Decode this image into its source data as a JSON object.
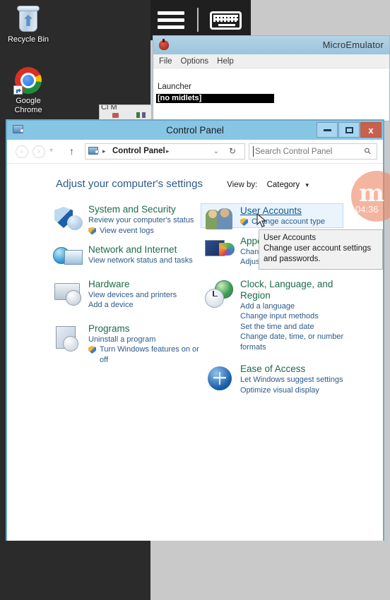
{
  "desktop": {
    "icons": [
      {
        "label": "Recycle Bin",
        "icon": "recycle-bin-icon"
      },
      {
        "label": "Google\nChrome",
        "label_line1": "Google",
        "label_line2": "Chrome",
        "icon": "google-chrome-icon"
      }
    ]
  },
  "emulator_overlay": {
    "menu_icon": "hamburger-icon",
    "keyboard_icon": "keyboard-icon"
  },
  "microemulator": {
    "title": "MicroEmulator",
    "window_icon": "microemulator-icon",
    "menus": [
      "File",
      "Options",
      "Help"
    ],
    "launcher_label": "Launcher",
    "selected_item": "[no midlets]"
  },
  "background_window": {
    "title_fragment": "Cl   M"
  },
  "control_panel": {
    "window_title": "Control Panel",
    "window_icon": "control-panel-icon",
    "window_buttons": {
      "minimize": "minimize-icon",
      "maximize": "maximize-icon",
      "close": "x"
    },
    "nav": {
      "back": "‹",
      "forward": "›",
      "recent_chevron": "▾",
      "up": "↑",
      "address_icon": "control-panel-icon",
      "breadcrumb_separator_1": "▸",
      "breadcrumb": "Control Panel",
      "breadcrumb_separator_2": "▸",
      "dropdown": "⌄",
      "refresh": "↻"
    },
    "search": {
      "placeholder": "Search Control Panel",
      "value": "",
      "icon": "search-icon"
    },
    "headline": "Adjust your computer's settings",
    "view_by": {
      "label": "View by:",
      "value": "Category",
      "arrow": "▾"
    },
    "categories_left": [
      {
        "title": "System and Security",
        "icon": "shield-icon",
        "links": [
          {
            "text": "Review your computer's status",
            "shield": false
          },
          {
            "text": "View event logs",
            "shield": true
          }
        ]
      },
      {
        "title": "Network and Internet",
        "icon": "network-icon",
        "links": [
          {
            "text": "View network status and tasks",
            "shield": false
          }
        ]
      },
      {
        "title": "Hardware",
        "icon": "hardware-icon",
        "links": [
          {
            "text": "View devices and printers",
            "shield": false
          },
          {
            "text": "Add a device",
            "shield": false
          }
        ]
      },
      {
        "title": "Programs",
        "icon": "programs-icon",
        "links": [
          {
            "text": "Uninstall a program",
            "shield": false
          },
          {
            "text": "Turn Windows features on or off",
            "shield": true
          }
        ]
      }
    ],
    "categories_right": [
      {
        "title": "User Accounts",
        "icon": "user-accounts-icon",
        "hovered": true,
        "links": [
          {
            "text": "Change account type",
            "shield": true
          }
        ]
      },
      {
        "title": "Appearance",
        "icon": "appearance-icon",
        "links": [
          {
            "text": "Change desktop background",
            "shield": false
          },
          {
            "text": "Adjust screen resolution",
            "shield": false
          }
        ]
      },
      {
        "title": "Clock, Language, and Region",
        "icon": "clock-language-region-icon",
        "links": [
          {
            "text": "Add a language",
            "shield": false
          },
          {
            "text": "Change input methods",
            "shield": false
          },
          {
            "text": "Set the time and date",
            "shield": false
          },
          {
            "text": "Change date, time, or number formats",
            "shield": false
          }
        ]
      },
      {
        "title": "Ease of Access",
        "icon": "ease-of-access-icon",
        "links": [
          {
            "text": "Let Windows suggest settings",
            "shield": false
          },
          {
            "text": "Optimize visual display",
            "shield": false
          }
        ]
      }
    ],
    "tooltip": {
      "title": "User Accounts",
      "description": "Change user account settings and passwords."
    }
  },
  "watermark": {
    "glyph": "m",
    "time": "04:36",
    "color": "#ee8866"
  }
}
